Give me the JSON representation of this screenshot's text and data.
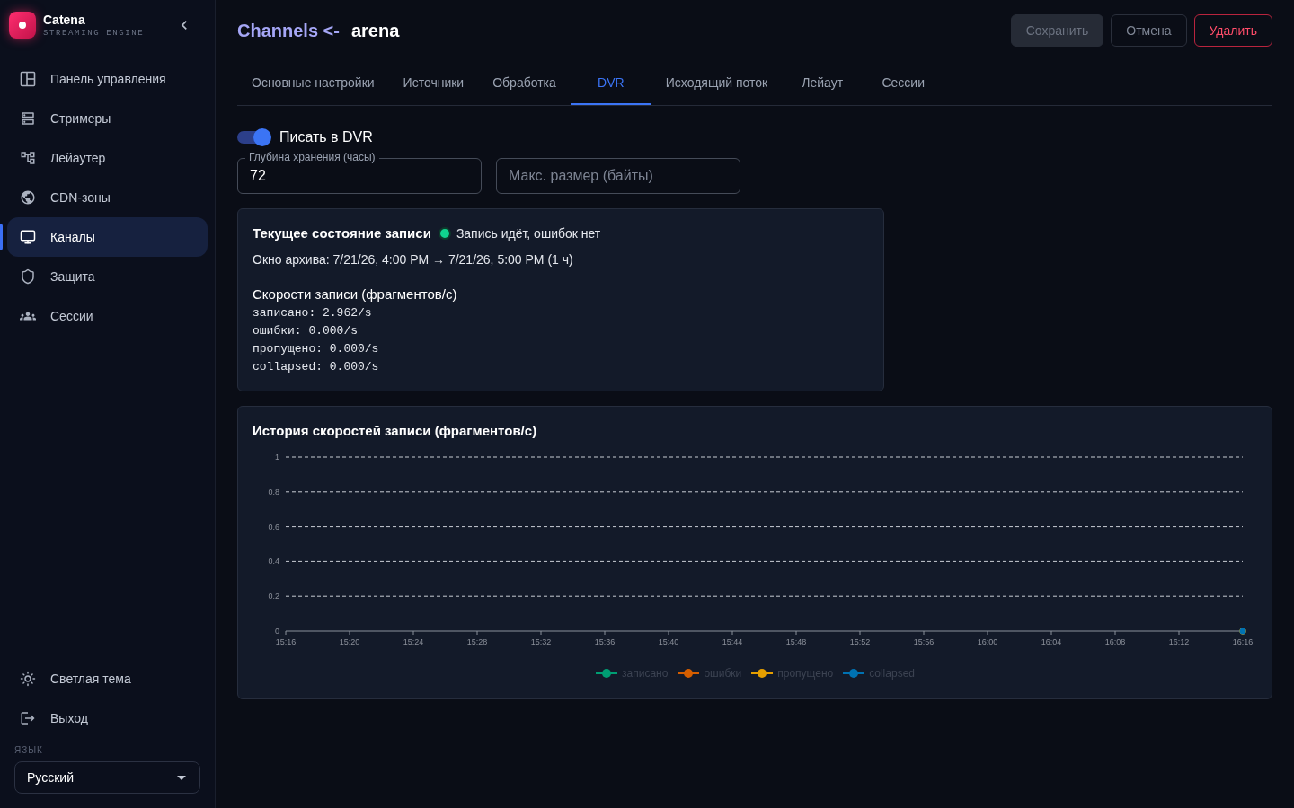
{
  "sidebar": {
    "brand": {
      "name": "Catena",
      "tagline": "STREAMING ENGINE"
    },
    "nav": [
      {
        "label": "Панель управления",
        "selected": false
      },
      {
        "label": "Стримеры",
        "selected": false
      },
      {
        "label": "Лейаутер",
        "selected": false
      },
      {
        "label": "CDN-зоны",
        "selected": false
      },
      {
        "label": "Каналы",
        "selected": true
      },
      {
        "label": "Защита",
        "selected": false
      },
      {
        "label": "Сессии",
        "selected": false
      }
    ],
    "footer": [
      {
        "label": "Светлая тема"
      },
      {
        "label": "Выход"
      }
    ],
    "language": {
      "label": "ЯЗЫК",
      "value": "Русский"
    }
  },
  "header": {
    "breadcrumb": "Channels <-",
    "title": "arena",
    "buttons": [
      {
        "label": "Сохранить",
        "kind": "primary",
        "disabled": true
      },
      {
        "label": "Отмена",
        "kind": "secondary",
        "disabled": false
      },
      {
        "label": "Удалить",
        "kind": "danger",
        "disabled": false
      }
    ]
  },
  "tabs": [
    {
      "label": "Основные настройки",
      "selected": false
    },
    {
      "label": "Источники",
      "selected": false
    },
    {
      "label": "Обработка",
      "selected": false
    },
    {
      "label": "DVR",
      "selected": true
    },
    {
      "label": "Исходящий поток",
      "selected": false
    },
    {
      "label": "Лейаут",
      "selected": false
    },
    {
      "label": "Сессии",
      "selected": false
    }
  ],
  "dvr": {
    "toggle": {
      "label": "Писать в DVR",
      "on": true
    },
    "fields": [
      {
        "label": "Глубина хранения (часы)",
        "value": "72"
      },
      {
        "placeholder": "Макс. размер (байты)"
      }
    ]
  },
  "status_card": {
    "title": "Текущее состояние записи",
    "status": {
      "ok": true,
      "text": "Запись идёт, ошибок нет"
    },
    "archive_window": "Окно архива: 7/21/26, 4:00 PM → 7/21/26, 5:00 PM (1 ч)",
    "rates_title": "Скорости записи (фрагментов/с)",
    "rates": [
      "записано: 2.962/s",
      "ошибки: 0.000/s",
      "пропущено: 0.000/s",
      "collapsed: 0.000/s"
    ]
  },
  "history_card": {
    "title": "История скоростей записи (фрагментов/с)",
    "chart_data": {
      "type": "line",
      "categories": [
        "15:16",
        "15:20",
        "15:24",
        "15:28",
        "15:32",
        "15:36",
        "15:40",
        "15:44",
        "15:48",
        "15:52",
        "15:56",
        "16:00",
        "16:04",
        "16:08",
        "16:12",
        "16:16"
      ],
      "series": [
        {
          "name": "записано",
          "color": "#009e73",
          "marker": "circle",
          "values": [
            null,
            null,
            null,
            null,
            null,
            null,
            null,
            null,
            null,
            null,
            null,
            null,
            null,
            null,
            null,
            0
          ]
        },
        {
          "name": "ошибки",
          "color": "#d55e00",
          "marker": "circle",
          "values": [
            null,
            null,
            null,
            null,
            null,
            null,
            null,
            null,
            null,
            null,
            null,
            null,
            null,
            null,
            null,
            0
          ]
        },
        {
          "name": "пропущено",
          "color": "#e69f00",
          "marker": "circle",
          "values": [
            null,
            null,
            null,
            null,
            null,
            null,
            null,
            null,
            null,
            null,
            null,
            null,
            null,
            null,
            null,
            0
          ]
        },
        {
          "name": "collapsed",
          "color": "#0072b2",
          "marker": "circle",
          "values": [
            null,
            null,
            null,
            null,
            null,
            null,
            null,
            null,
            null,
            null,
            null,
            null,
            null,
            null,
            null,
            0
          ]
        }
      ],
      "ylim": [
        0,
        1
      ],
      "yticks": [
        0,
        0.2,
        0.4,
        0.6,
        0.8,
        1
      ],
      "grid": true,
      "legend": "bottom"
    }
  }
}
